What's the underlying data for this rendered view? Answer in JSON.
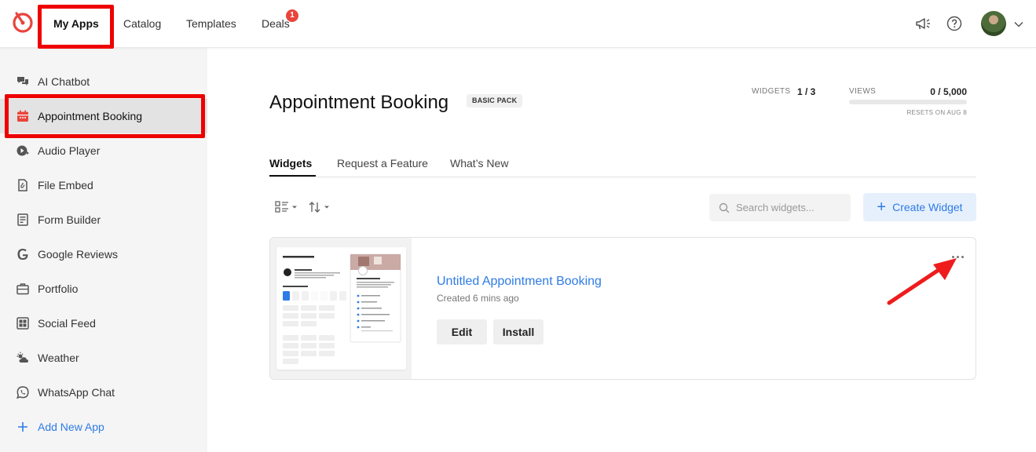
{
  "topbar": {
    "nav": [
      "My Apps",
      "Catalog",
      "Templates",
      "Deals"
    ],
    "deals_badge": "1",
    "brand_color": "#e8453c",
    "icons": [
      "logo-icon",
      "megaphone-icon",
      "help-icon",
      "avatar",
      "chevron-down-icon"
    ]
  },
  "sidebar": {
    "items": [
      {
        "label": "AI Chatbot",
        "icon": "chat-bubbles-icon"
      },
      {
        "label": "Appointment Booking",
        "icon": "calendar-icon"
      },
      {
        "label": "Audio Player",
        "icon": "audio-player-icon"
      },
      {
        "label": "File Embed",
        "icon": "paperclip-file-icon"
      },
      {
        "label": "Form Builder",
        "icon": "form-icon"
      },
      {
        "label": "Google Reviews",
        "icon": "google-icon"
      },
      {
        "label": "Portfolio",
        "icon": "briefcase-icon"
      },
      {
        "label": "Social Feed",
        "icon": "social-grid-icon"
      },
      {
        "label": "Weather",
        "icon": "weather-icon"
      },
      {
        "label": "WhatsApp Chat",
        "icon": "whatsapp-icon"
      }
    ],
    "add_label": "Add New App",
    "active_index": 1
  },
  "main": {
    "title": "Appointment Booking",
    "pack": "BASIC PACK",
    "stats": {
      "widgets_label": "WIDGETS",
      "widgets_value": "1 / 3",
      "views_label": "VIEWS",
      "views_value": "0 / 5,000",
      "views_progress": 0,
      "reset_note": "RESETS ON AUG 8"
    },
    "tabs": [
      "Widgets",
      "Request a Feature",
      "What’s New"
    ],
    "active_tab": 0,
    "search_placeholder": "Search widgets...",
    "create_label": "Create Widget",
    "accent": "#2e7be6"
  },
  "widget": {
    "title": "Untitled Appointment Booking",
    "created": "Created 6 mins ago",
    "edit_label": "Edit",
    "install_label": "Install"
  }
}
